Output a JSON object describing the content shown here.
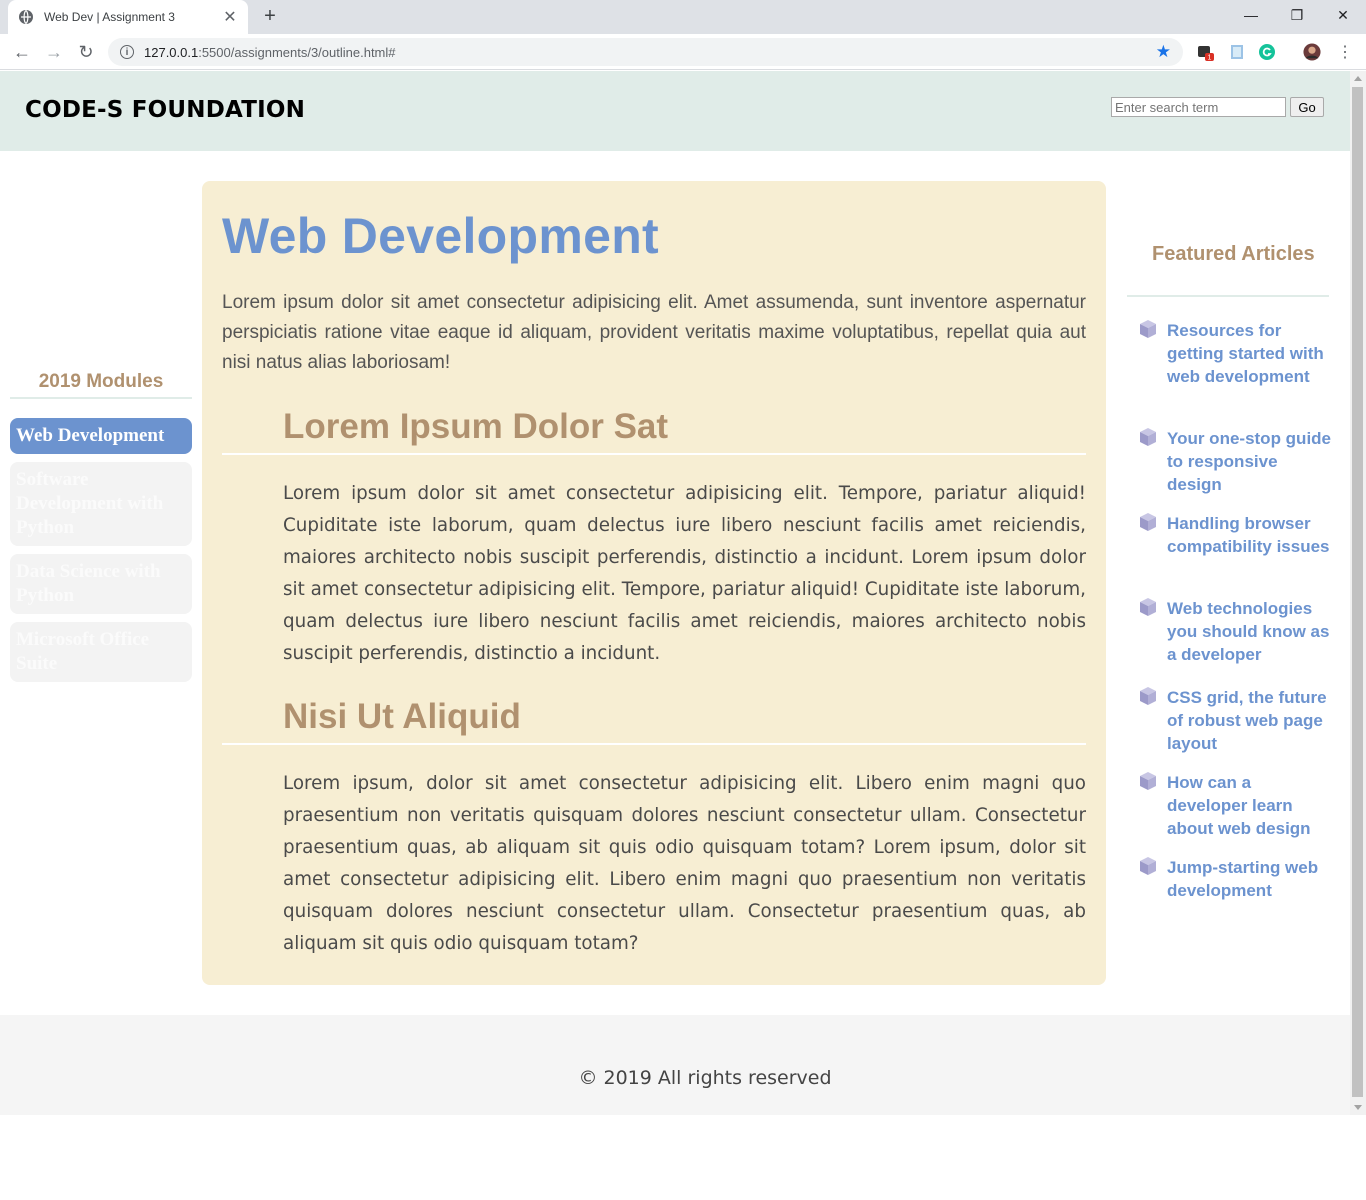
{
  "browser": {
    "tab_title": "Web Dev | Assignment 3",
    "new_tab": "+",
    "url_host": "127.0.0.1",
    "url_rest": ":5500/assignments/3/outline.html#",
    "badge": "1"
  },
  "header": {
    "brand": "CODE-S FOUNDATION",
    "search_placeholder": "Enter search term",
    "go_label": "Go"
  },
  "sidebar": {
    "title": "2019 Modules",
    "items": [
      {
        "label": "Web Development",
        "active": true
      },
      {
        "label": "Software Development with Python",
        "active": false
      },
      {
        "label": "Data Science with Python",
        "active": false
      },
      {
        "label": "Microsoft Office Suite",
        "active": false
      }
    ]
  },
  "main": {
    "title": "Web Development",
    "intro": "Lorem ipsum dolor sit amet consectetur adipisicing elit. Amet assumenda, sunt inventore aspernatur perspiciatis ratione vitae eaque id aliquam, provident veritatis maxime voluptatibus, repellat quia aut nisi natus alias laboriosam!",
    "sections": [
      {
        "heading": "Lorem Ipsum Dolor Sat",
        "text": "Lorem ipsum dolor sit amet consectetur adipisicing elit. Tempore, pariatur aliquid! Cupiditate iste laborum, quam delectus iure libero nesciunt facilis amet reiciendis, maiores architecto nobis suscipit perferendis, distinctio a incidunt. Lorem ipsum dolor sit amet consectetur adipisicing elit. Tempore, pariatur aliquid! Cupiditate iste laborum, quam delectus iure libero nesciunt facilis amet reiciendis, maiores architecto nobis suscipit perferendis, distinctio a incidunt."
      },
      {
        "heading": "Nisi Ut Aliquid",
        "text": "Lorem ipsum, dolor sit amet consectetur adipisicing elit. Libero enim magni quo praesentium non veritatis quisquam dolores nesciunt consectetur ullam. Consectetur praesentium quas, ab aliquam sit quis odio quisquam totam? Lorem ipsum, dolor sit amet consectetur adipisicing elit. Libero enim magni quo praesentium non veritatis quisquam dolores nesciunt consectetur ullam. Consectetur praesentium quas, ab aliquam sit quis odio quisquam totam?"
      }
    ]
  },
  "featured": {
    "title": "Featured Articles",
    "icon": "cube-icon",
    "articles": [
      "Resources for getting started with web development",
      "Your one-stop guide to responsive design",
      "Handling browser compatibility issues",
      "Web technologies you should know as a developer",
      "CSS grid, the future of robust web page layout",
      "How can a developer learn about web design",
      "Jump-starting web development"
    ]
  },
  "footer": {
    "copyright": "© 2019 All rights reserved"
  },
  "colors": {
    "accent_blue": "#6c93cf",
    "accent_tan": "#b0916f",
    "header_bg": "#e0ece8",
    "content_bg": "#f7eed3"
  }
}
